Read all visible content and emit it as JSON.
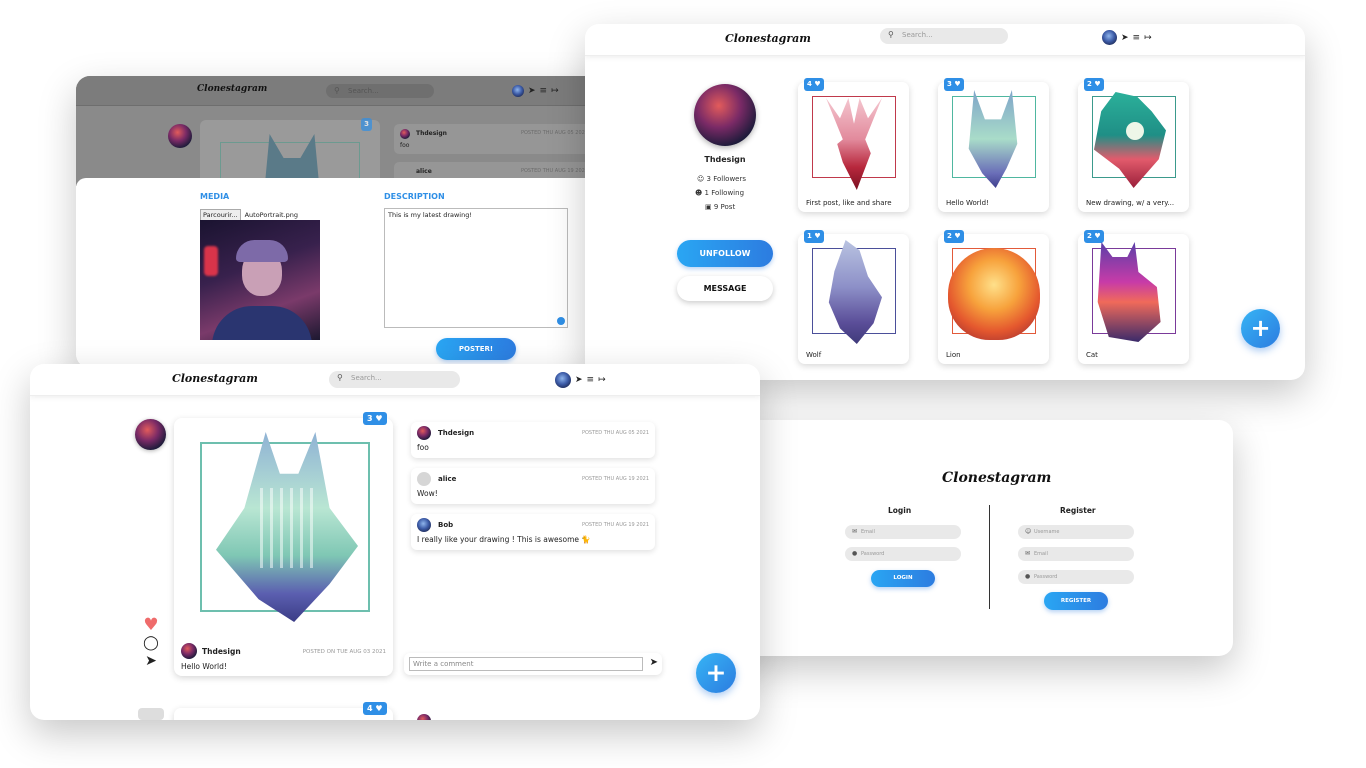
{
  "app": {
    "logo": "Clonestagram",
    "search_placeholder": "Search..."
  },
  "upload_window": {
    "media_label": "MEDIA",
    "file_button": "Parcourir...",
    "file_name": "AutoPortrait.png",
    "description_label": "DESCRIPTION",
    "description_value": "This is my latest drawing!",
    "submit": "POSTER!",
    "bg_badge": "3",
    "bg_comments": [
      {
        "name": "Thdesign",
        "text": "foo",
        "date": "POSTED THU AUG 05 2021"
      },
      {
        "name": "alice",
        "date": "POSTED THU AUG 19 2021"
      }
    ]
  },
  "profile_window": {
    "username": "Thdesign",
    "followers": "3 Followers",
    "following": "1 Following",
    "posts": "9 Post",
    "unfollow": "UNFOLLOW",
    "message": "MESSAGE",
    "fab": "+",
    "grid": [
      {
        "likes": "4",
        "caption": "First post, like and share"
      },
      {
        "likes": "3",
        "caption": "Hello World!"
      },
      {
        "likes": "2",
        "caption": "New drawing, w/ a very..."
      },
      {
        "likes": "1",
        "caption": "Wolf"
      },
      {
        "likes": "2",
        "caption": "Lion"
      },
      {
        "likes": "2",
        "caption": "Cat"
      }
    ]
  },
  "post_window": {
    "likes": "3",
    "author": "Thdesign",
    "date": "POSTED ON TUE AUG 03 2021",
    "caption": "Hello World!",
    "next_likes": "4",
    "comments": [
      {
        "name": "Thdesign",
        "date": "POSTED THU AUG 05 2021",
        "text": "foo"
      },
      {
        "name": "alice",
        "date": "POSTED THU AUG 19 2021",
        "text": "Wow!"
      },
      {
        "name": "Bob",
        "date": "POSTED THU AUG 19 2021",
        "text": "I really like your drawing ! This is awesome 🐈"
      }
    ],
    "comment_placeholder": "Write a comment",
    "fab": "+"
  },
  "login_window": {
    "logo": "Clonestagram",
    "login_title": "Login",
    "register_title": "Register",
    "login_fields": [
      "Email",
      "Password"
    ],
    "register_fields": [
      "Username",
      "Email",
      "Password"
    ],
    "login_button": "LOGIN",
    "register_button": "REGISTER"
  },
  "colors": {
    "accent": "#2f8fe6",
    "heart": "#ef6b6b",
    "deer": "#c0394b",
    "fox": "#4fb7a0",
    "wolf": "#6d6fb8",
    "lion": "#f07a3a",
    "cat": "#9b3fa8"
  },
  "icons": [
    "search-icon",
    "send-icon",
    "sliders-icon",
    "logout-icon",
    "heart-icon",
    "comment-icon",
    "user-icon",
    "users-icon",
    "image-icon",
    "email-icon",
    "lock-icon"
  ]
}
